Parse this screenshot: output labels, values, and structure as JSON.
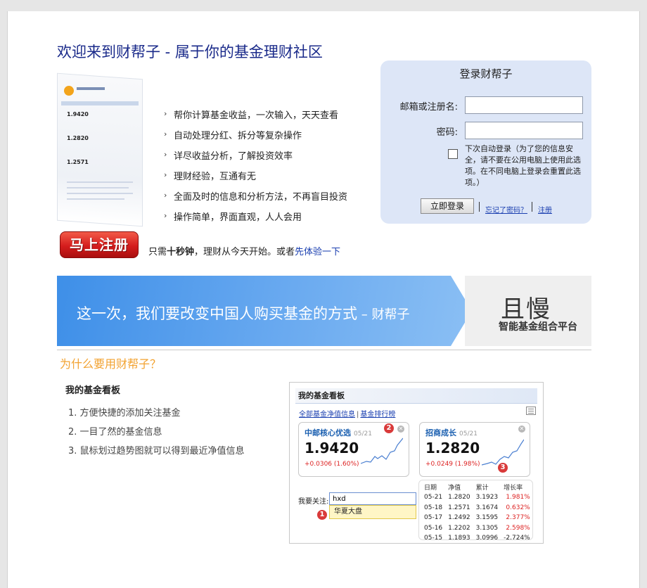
{
  "headline": "欢迎来到财帮子 - 属于你的基金理财社区",
  "screenshot_preview": {
    "nums": [
      "1.9420",
      "1.2820",
      "1.2571"
    ]
  },
  "features": [
    "帮你计算基金收益，一次输入，天天查看",
    "自动处理分红、拆分等复杂操作",
    "详尽收益分析，了解投资效率",
    "理财经验，互通有无",
    "全面及时的信息和分析方法，不再盲目投资",
    "操作简单，界面直观，人人会用"
  ],
  "register": {
    "button": "马上注册",
    "note_prefix": "只需",
    "note_bold": "十秒钟",
    "note_mid": "，理财从今天开始。或者",
    "note_link": "先体验一下"
  },
  "login": {
    "title": "登录财帮子",
    "email_label": "邮箱或注册名:",
    "password_label": "密码:",
    "email_value": "",
    "password_value": "",
    "remember_text": "下次自动登录（为了您的信息安全，请不要在公用电脑上使用此选项。在不同电脑上登录会重置此选项。）",
    "submit": "立即登录",
    "forgot": "忘记了密码？",
    "signup": "注册"
  },
  "banner": {
    "slogan": "这一次，我们要改变中国人购买基金的方式",
    "signature": " – 财帮子",
    "brand": "且慢",
    "brand_sub": "智能基金组合平台"
  },
  "why_title": "为什么要用财帮子？",
  "board": {
    "title": "我的基金看板",
    "items": [
      "1.  方便快捷的添加关注基金",
      "2.  一目了然的基金信息",
      "3.  鼠标划过趋势图就可以得到最近净值信息"
    ]
  },
  "demo": {
    "header": "我的基金看板",
    "tab_all": "全部基金净值信息",
    "tab_rank": "基金排行榜",
    "cards": [
      {
        "name": "中邮核心优选",
        "date": "05/21",
        "nav": "1.9420",
        "change": "+0.0306 (1.60%)",
        "badge": "2"
      },
      {
        "name": "招商成长",
        "date": "05/21",
        "nav": "1.2820",
        "change": "+0.0249 (1.98%)",
        "badge": "3"
      }
    ],
    "watch_label": "我要关注:",
    "watch_value": "hxd",
    "suggestion": "华夏大盘",
    "suggest_badge": "1",
    "table": {
      "headers": [
        "日期",
        "净值",
        "累计",
        "增长率"
      ],
      "rows": [
        [
          "05-21",
          "1.2820",
          "3.1923",
          "1.981%"
        ],
        [
          "05-18",
          "1.2571",
          "3.1674",
          "0.632%"
        ],
        [
          "05-17",
          "1.2492",
          "3.1595",
          "2.377%"
        ],
        [
          "05-16",
          "1.2202",
          "3.1305",
          "2.598%"
        ],
        [
          "05-15",
          "1.1893",
          "3.0996",
          "-2.724%"
        ]
      ]
    }
  },
  "colors": {
    "link": "#1a3fb0",
    "accent_orange": "#f2a230",
    "login_bg": "#dde6f7",
    "red": "#d22222"
  }
}
